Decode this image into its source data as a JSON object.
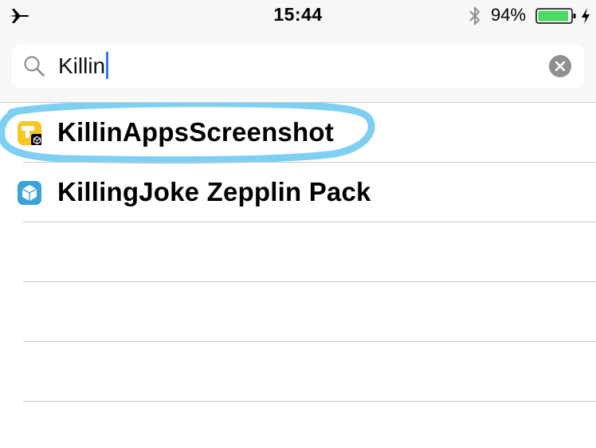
{
  "status_bar": {
    "time": "15:44",
    "battery_percent": "94%",
    "battery_level": 0.94,
    "icons": [
      "airplane-icon",
      "bluetooth-icon",
      "battery-icon",
      "charging-bolt-icon"
    ]
  },
  "search": {
    "query": "Killin",
    "icons": [
      "search-icon",
      "clear-icon"
    ]
  },
  "results": [
    {
      "label": "KillinAppsScreenshot",
      "icon": "killinapps-app-icon",
      "highlighted": true
    },
    {
      "label": "KillingJoke Zepplin Pack",
      "icon": "zepplin-pack-icon",
      "highlighted": false
    }
  ],
  "colors": {
    "highlight_marker": "#7fcff2",
    "accent": "#3478f6",
    "battery": "#4cd964"
  }
}
